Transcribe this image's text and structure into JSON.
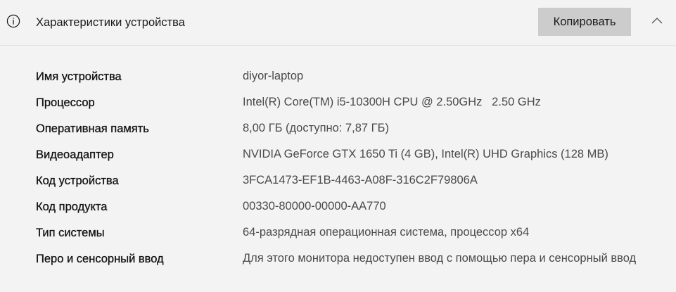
{
  "section": {
    "title": "Характеристики устройства",
    "copy_label": "Копировать",
    "icons": {
      "info": "info-icon",
      "collapse": "chevron-up-icon"
    }
  },
  "specs": [
    {
      "label": "Имя устройства",
      "value": "diyor-laptop"
    },
    {
      "label": "Процессор",
      "value": "Intel(R) Core(TM) i5-10300H CPU @ 2.50GHz   2.50 GHz"
    },
    {
      "label": "Оперативная память",
      "value": "8,00 ГБ (доступно: 7,87 ГБ)"
    },
    {
      "label": "Видеоадаптер",
      "value": "NVIDIA GeForce GTX 1650 Ti (4 GB), Intel(R) UHD Graphics (128 MB)"
    },
    {
      "label": "Код устройства",
      "value": "3FCA1473-EF1B-4463-A08F-316C2F79806A"
    },
    {
      "label": "Код продукта",
      "value": "00330-80000-00000-AA770"
    },
    {
      "label": "Тип системы",
      "value": "64-разрядная операционная система, процессор x64"
    },
    {
      "label": "Перо и сенсорный ввод",
      "value": "Для этого монитора недоступен ввод с помощью пера и сенсорный ввод"
    }
  ],
  "colors": {
    "background": "#f3f3f3",
    "button": "#cccccc",
    "label_text": "#111111",
    "value_text": "#4a4a4a",
    "divider": "#e2e2e2"
  }
}
